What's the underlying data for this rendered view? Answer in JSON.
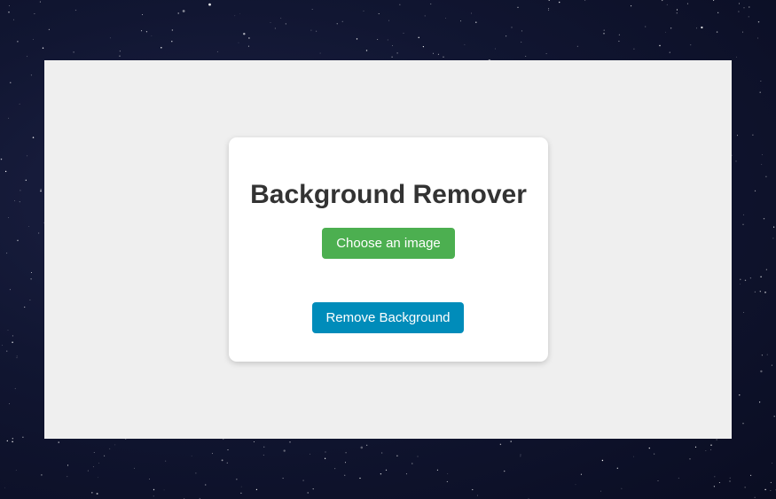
{
  "app": {
    "title": "Background Remover"
  },
  "actions": {
    "choose_label": "Choose an image",
    "remove_label": "Remove Background"
  },
  "colors": {
    "choose_button": "#4caf50",
    "remove_button": "#008cba",
    "page_background": "#efefef",
    "card_background": "#ffffff",
    "title_text": "#333333"
  }
}
